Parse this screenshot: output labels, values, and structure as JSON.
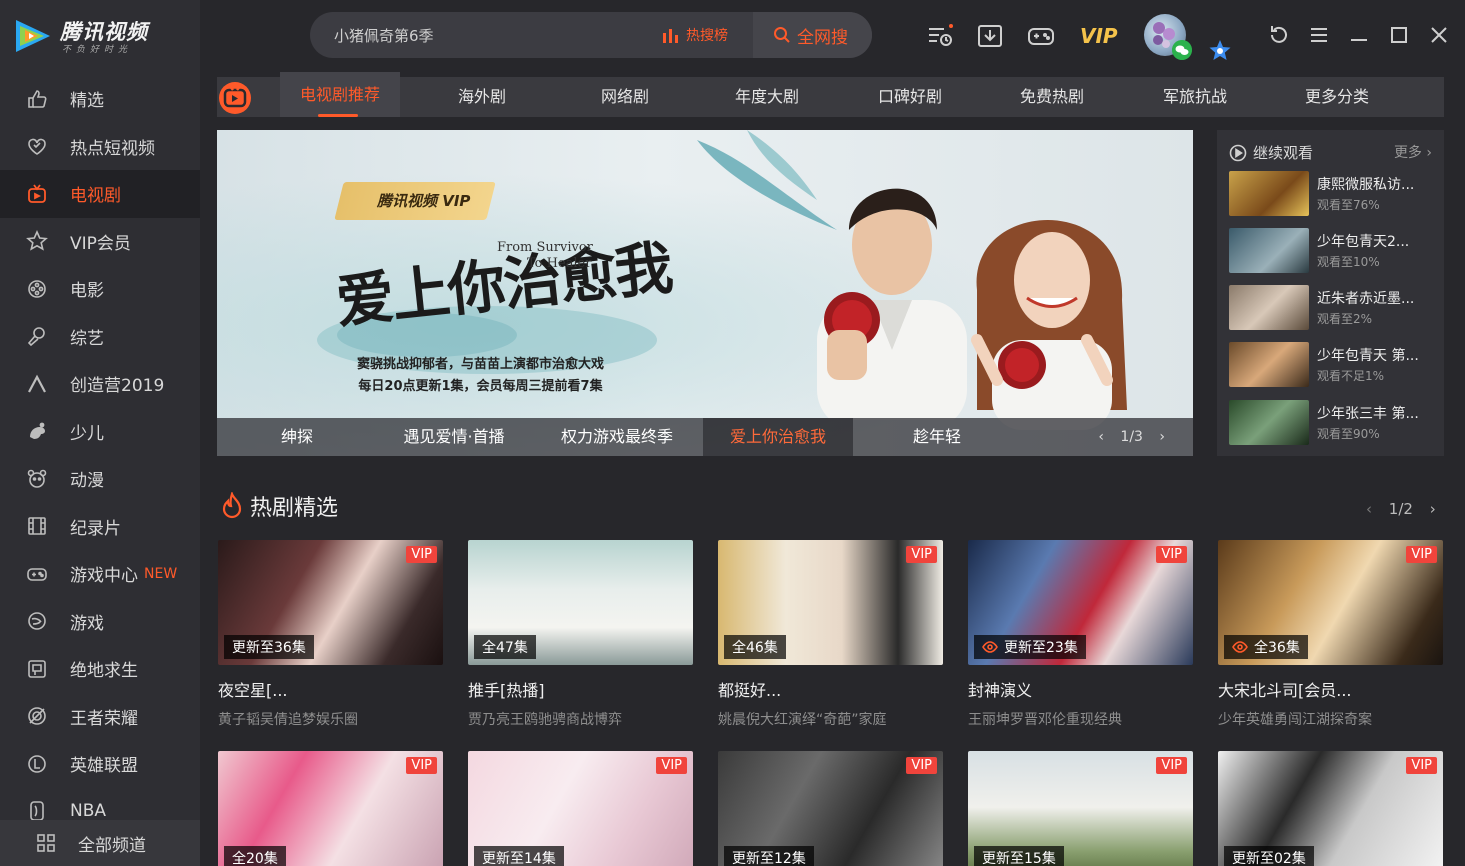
{
  "app": {
    "logo_text": "腾讯视频",
    "logo_slogan": "不负好时光"
  },
  "sidebar": {
    "items": [
      {
        "label": "精选",
        "icon": "thumbs-up-icon"
      },
      {
        "label": "热点短视频",
        "icon": "heart-icon"
      },
      {
        "label": "电视剧",
        "icon": "tv-icon",
        "active": true
      },
      {
        "label": "VIP会员",
        "icon": "star-icon"
      },
      {
        "label": "电影",
        "icon": "film-reel-icon"
      },
      {
        "label": "综艺",
        "icon": "microphone-icon"
      },
      {
        "label": "创造营2019",
        "icon": "chevron-up-logo-icon"
      },
      {
        "label": "少儿",
        "icon": "kids-icon"
      },
      {
        "label": "动漫",
        "icon": "anime-face-icon"
      },
      {
        "label": "纪录片",
        "icon": "film-strip-icon"
      },
      {
        "label": "游戏中心",
        "badge": "NEW",
        "icon": "gamepad-icon"
      },
      {
        "label": "游戏",
        "icon": "game-swirl-icon"
      },
      {
        "label": "绝地求生",
        "icon": "pubg-icon"
      },
      {
        "label": "王者荣耀",
        "icon": "honor-of-kings-icon"
      },
      {
        "label": "英雄联盟",
        "icon": "lol-icon"
      },
      {
        "label": "NBA",
        "icon": "nba-icon"
      }
    ],
    "all_channels": "全部频道"
  },
  "search": {
    "value": "小猪佩奇第6季",
    "hot_rank": "热搜榜",
    "button": "全网搜"
  },
  "toolbar": {
    "vip": "VIP"
  },
  "tabs": [
    {
      "label": "电视剧推荐",
      "active": true
    },
    {
      "label": "海外剧"
    },
    {
      "label": "网络剧"
    },
    {
      "label": "年度大剧"
    },
    {
      "label": "口碑好剧"
    },
    {
      "label": "免费热剧"
    },
    {
      "label": "军旅抗战"
    },
    {
      "label": "更多分类"
    }
  ],
  "banner": {
    "vip_tag": "腾讯视频 VIP",
    "title": "爱上你治愈我",
    "en_line1": "From Survivor",
    "en_line2": "To Healer",
    "sub_line1": "窦骁挑战抑郁者，与苗苗上演都市治愈大戏",
    "sub_line2": "每日20点更新1集，会员每周三提前看7集",
    "strip": [
      "绅探",
      "遇见爱情·首播",
      "权力游戏最终季",
      "爱上你治愈我",
      "趁年轻"
    ],
    "active_strip_index": 3,
    "pager": "1/3"
  },
  "continue_watching": {
    "title": "继续观看",
    "more": "更多",
    "items": [
      {
        "title": "康熙微服私访...",
        "progress": "观看至76%"
      },
      {
        "title": "少年包青天2...",
        "progress": "观看至10%"
      },
      {
        "title": "近朱者赤近墨...",
        "progress": "观看至2%"
      },
      {
        "title": "少年包青天 第...",
        "progress": "观看不足1%"
      },
      {
        "title": "少年张三丰 第...",
        "progress": "观看至90%"
      }
    ]
  },
  "hot_section": {
    "title": "热剧精选",
    "pager": "1/2",
    "cards_row1": [
      {
        "title": "夜空星[...",
        "desc": "黄子韬吴倩追梦娱乐圈",
        "episode": "更新至36集",
        "vip": "VIP"
      },
      {
        "title": "推手[热播]",
        "desc": "贾乃亮王鸥驰骋商战博弈",
        "episode": "全47集",
        "vip": ""
      },
      {
        "title": "都挺好...",
        "desc": "姚晨倪大红演绎“奇葩”家庭",
        "episode": "全46集",
        "vip": "VIP"
      },
      {
        "title": "封神演义",
        "desc": "王丽坤罗晋邓伦重现经典",
        "episode": "更新至23集",
        "vip": "VIP"
      },
      {
        "title": "大宋北斗司[会员...",
        "desc": "少年英雄勇闯江湖探奇案",
        "episode": "全36集",
        "vip": "VIP"
      }
    ],
    "cards_row2": [
      {
        "episode": "全20集",
        "vip": "VIP"
      },
      {
        "episode": "更新至14集",
        "vip": "VIP"
      },
      {
        "episode": "更新至12集",
        "vip": "VIP"
      },
      {
        "episode": "更新至15集",
        "vip": "VIP"
      },
      {
        "episode": "更新至02集",
        "vip": "VIP"
      }
    ]
  },
  "colors": {
    "accent": "#ff5a2a",
    "vip_gold": "#f5c34b",
    "bg": "#27272b",
    "sidebar": "#2e2e33"
  }
}
